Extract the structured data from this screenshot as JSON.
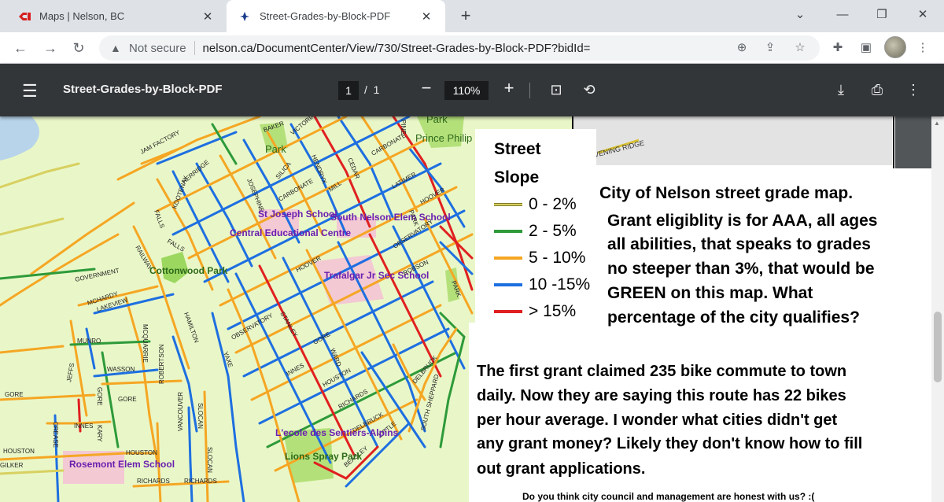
{
  "browser": {
    "tabs": [
      {
        "title": "Maps | Nelson, BC",
        "favicon": "cp-logo-icon",
        "active": false
      },
      {
        "title": "Street-Grades-by-Block-PDF",
        "favicon": "city-logo-icon",
        "active": true
      }
    ],
    "security_label": "Not secure",
    "url": "nelson.ca/DocumentCenter/View/730/Street-Grades-by-Block-PDF?bidId="
  },
  "pdf_viewer": {
    "title": "Street-Grades-by-Block-PDF",
    "page_current": "1",
    "page_separator": "/",
    "page_total": "1",
    "zoom": "110%"
  },
  "legend": {
    "title_line1": "Street",
    "title_line2": "Slope",
    "items": [
      {
        "label": "0 - 2%",
        "color": "#d8d060"
      },
      {
        "label": "2 - 5%",
        "color": "#2e9a3a"
      },
      {
        "label": "5 - 10%",
        "color": "#f5a623"
      },
      {
        "label": "10 -15%",
        "color": "#1e6fe0"
      },
      {
        "label": "> 15%",
        "color": "#e02020"
      }
    ]
  },
  "annotation_1": [
    "City of Nelson street grade map.",
    "Grant eligiblity is for AAA, all ages",
    "all abilities, that speaks to grades",
    "no steeper than 3%, that would be",
    "GREEN on this map.  What",
    "percentage of the city qualifies?"
  ],
  "annotation_2": [
    "The first grant claimed 235 bike commute to town",
    "daily.  Now they are saying this route has 22 bikes",
    "per hour average.  I wonder what cities didn't get",
    "any grant money?  Likely they don't know how to fill",
    "out grant applications."
  ],
  "annotation_3": "Do you think city council and management are honest with us? :(",
  "map_labels": {
    "jam_factory": "JAM FACTORY",
    "baker": "BAKER",
    "victoria": "VICTORIA",
    "park_top": "Park",
    "prince_philip": "Prince Philip",
    "park_pp": "Park",
    "herridge": "HERRIDGE",
    "kootenay": "KOOTENAY",
    "josephine": "JOSEPHINE",
    "silica": "SILICA",
    "hendryx": "HENDRYX",
    "cedar": "CEDAR",
    "carbonate": "CARBONATE",
    "carbonate2": "CARBONATE",
    "mill": "MILL",
    "latimer": "LATIMER",
    "hoover": "HOOVER",
    "hoover2": "HOOVER",
    "st_joseph": "St Joseph School",
    "south_nelson": "South Nelson Elem School",
    "central_ed": "Central Educational Centre",
    "falls": "FALLS",
    "falls2": "FALLS",
    "railway": "RAILWAY",
    "cottonwood": "Cottonwood Park",
    "government": "GOVERNMENT",
    "observatory": "OBSERVATORY",
    "observatory2": "OBSERVATORY",
    "trafalgar": "Trafalgar Jr Sec School",
    "robson": "ROBSON",
    "mchardy": "MCHARDY",
    "lakeview": "LAKEVIEW",
    "munro": "MUNRO",
    "mcquarrie": "MCQUARRIE",
    "hamilton": "HAMILTON",
    "stanley": "STANLEY",
    "gore": "GORE",
    "gore2": "GORE",
    "gore3": "GORE",
    "ward": "WARD",
    "wasson": "WASSON",
    "jeffs": "JEFFS",
    "robertson": "ROBERTSON",
    "innes": "INNES",
    "innes2": "INNES",
    "houston": "HOUSTON",
    "houston2": "HOUSTON",
    "houston3": "HOUSTON",
    "richards": "RICHARDS",
    "richards2": "RICHARDS",
    "richards3": "RICHARDS",
    "delbruck": "DELBRUCK",
    "delbruck2": "DELBRUCK",
    "south_sheppard": "SOUTH SHEPPARD",
    "little": "LITTLE",
    "beasley": "BEASLEY",
    "slocan": "SLOCAN",
    "vancouver": "VANCOUVER",
    "crease": "CREASE",
    "kary": "KARY",
    "gilker": "GILKER",
    "rosemont": "Rosemont Elem School",
    "lecole": "L'ecole des Sentiers-Alpins",
    "lions": "Lions Spray Park",
    "park_right": "PARK",
    "park_right2": "PARK",
    "vening_ridge": "VENING RIDGE",
    "yaxe": "YAXE",
    "pine": "PINE"
  }
}
